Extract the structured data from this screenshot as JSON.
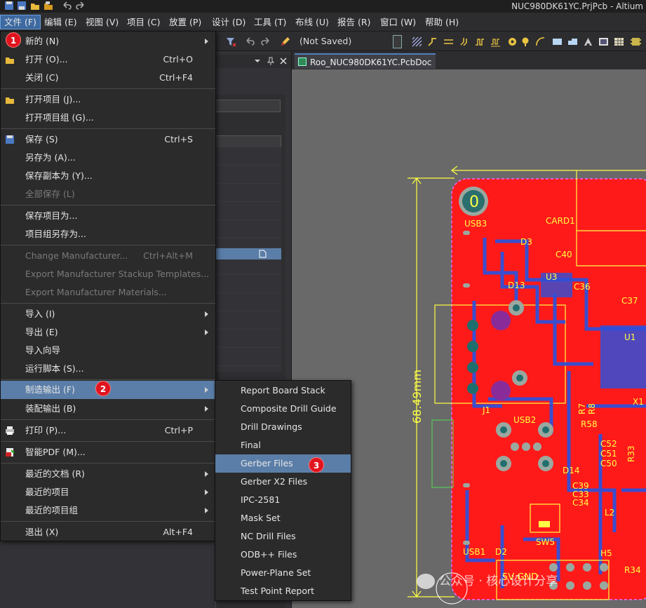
{
  "window": {
    "title": "NUC980DK61YC.PrjPcb - Altium"
  },
  "menubar": {
    "items": [
      {
        "label": "文件 (F)"
      },
      {
        "label": "编辑 (E)"
      },
      {
        "label": "视图 (V)"
      },
      {
        "label": "项目 (C)"
      },
      {
        "label": "放置 (P)"
      },
      {
        "label": "设计 (D)"
      },
      {
        "label": "工具 (T)"
      },
      {
        "label": "布线 (U)"
      },
      {
        "label": "报告 (R)"
      },
      {
        "label": "窗口 (W)"
      },
      {
        "label": "帮助 (H)"
      }
    ]
  },
  "toolbar": {
    "status": "(Not Saved)"
  },
  "document_tab": {
    "label": "Roo_NUC980DK61YC.PcbDoc"
  },
  "file_menu": {
    "items": [
      {
        "label": "新的 (N)",
        "shortcut": "",
        "submenu": true
      },
      {
        "label": "打开 (O)...",
        "shortcut": "Ctrl+O"
      },
      {
        "label": "关闭 (C)",
        "shortcut": "Ctrl+F4"
      },
      {
        "label": "打开项目 (J)..."
      },
      {
        "label": "打开项目组 (G)..."
      },
      {
        "label": "保存 (S)",
        "shortcut": "Ctrl+S"
      },
      {
        "label": "另存为 (A)..."
      },
      {
        "label": "保存副本为 (Y)..."
      },
      {
        "label": "全部保存 (L)"
      },
      {
        "label": "保存项目为..."
      },
      {
        "label": "项目组另存为..."
      },
      {
        "label": "Change Manufacturer...",
        "shortcut": "Ctrl+Alt+M"
      },
      {
        "label": "Export Manufacturer Stackup Templates..."
      },
      {
        "label": "Export Manufacturer Materials..."
      },
      {
        "label": "导入 (I)"
      },
      {
        "label": "导出 (E)"
      },
      {
        "label": "导入向导"
      },
      {
        "label": "运行脚本 (S)..."
      },
      {
        "label": "制造输出 (F)"
      },
      {
        "label": "装配输出 (B)"
      },
      {
        "label": "打印 (P)...",
        "shortcut": "Ctrl+P"
      },
      {
        "label": "智能PDF (M)..."
      },
      {
        "label": "最近的文档 (R)"
      },
      {
        "label": "最近的项目"
      },
      {
        "label": "最近的项目组"
      },
      {
        "label": "退出 (X)",
        "shortcut": "Alt+F4"
      }
    ]
  },
  "fab_submenu": {
    "items": [
      {
        "label": "Report Board Stack"
      },
      {
        "label": "Composite Drill Guide"
      },
      {
        "label": "Drill Drawings"
      },
      {
        "label": "Final"
      },
      {
        "label": "Gerber Files"
      },
      {
        "label": "Gerber X2 Files"
      },
      {
        "label": "IPC-2581"
      },
      {
        "label": "Mask Set"
      },
      {
        "label": "NC Drill Files"
      },
      {
        "label": "ODB++ Files"
      },
      {
        "label": "Power-Plane Set"
      },
      {
        "label": "Test Point Report"
      }
    ]
  },
  "badges": [
    "1",
    "2",
    "3"
  ],
  "pcb": {
    "dimension": "68.49mm",
    "labels": [
      "USB3",
      "CARD1",
      "D3",
      "C40",
      "D13",
      "U3",
      "C36",
      "C37",
      "J1",
      "USB2",
      "D14",
      "R7",
      "R8",
      "R58",
      "C52",
      "C51",
      "C50",
      "C39",
      "C33",
      "C34",
      "SW5",
      "D2",
      "USB1",
      "L2",
      "H5",
      "R33",
      "R34",
      "5V GND",
      "X1",
      "U1"
    ]
  },
  "watermark": {
    "text": "公众号 · 核心设计分享"
  },
  "colors": {
    "board": "#ff1a1a",
    "silk": "#ffd700",
    "highlight": "#5b7ea8",
    "badge": "#e0141e"
  }
}
